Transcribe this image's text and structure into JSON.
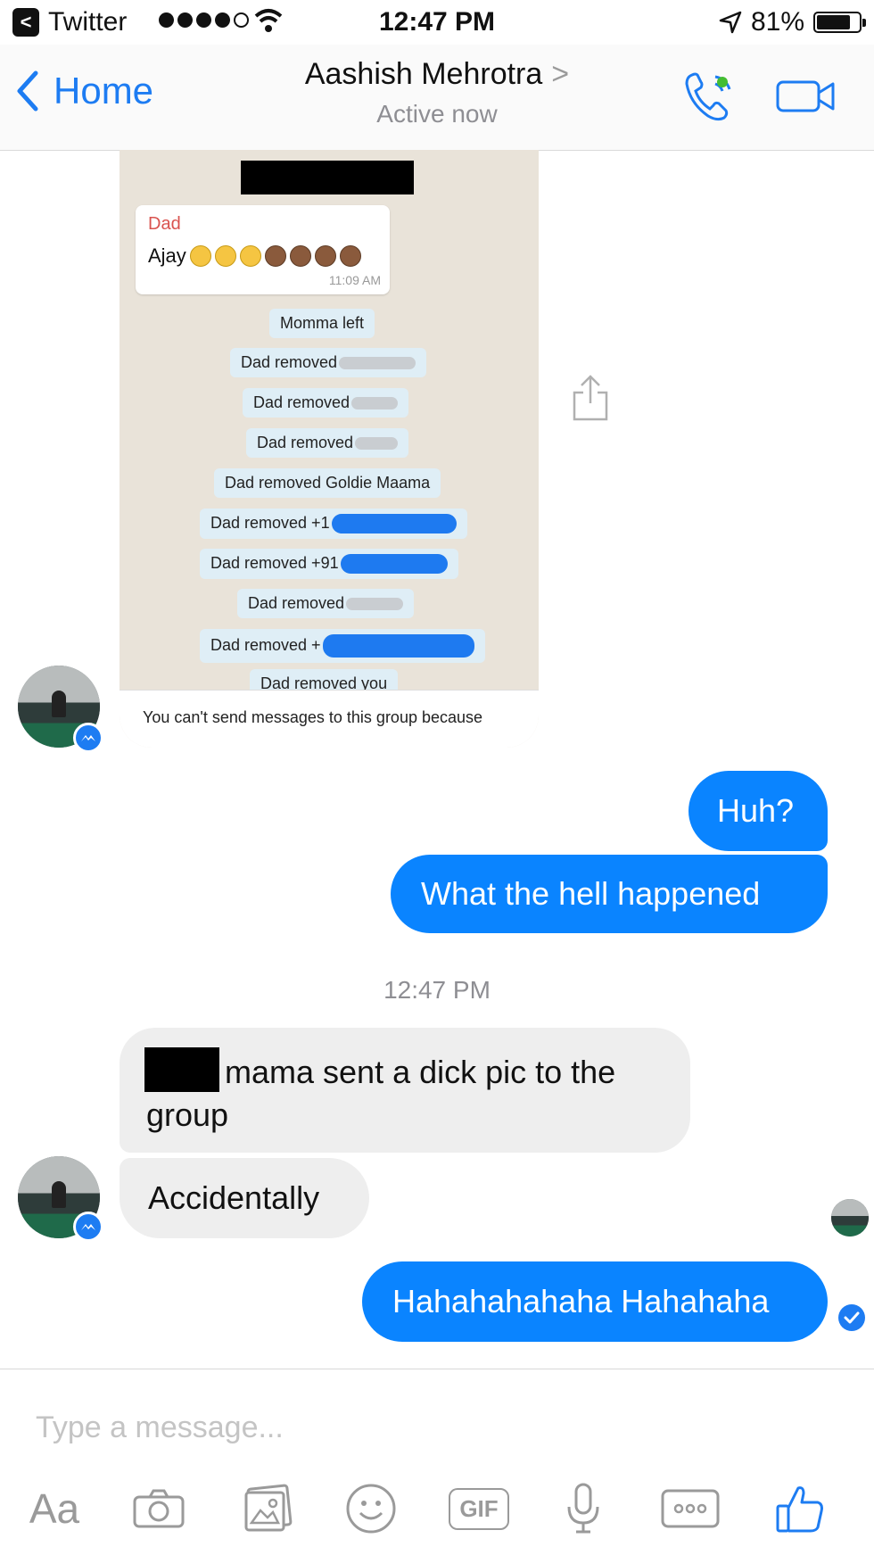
{
  "status_bar": {
    "back_app": "Twitter",
    "back_glyph": "<",
    "time": "12:47 PM",
    "battery": "81%",
    "battery_level": 0.81,
    "signal_bars_filled": 4,
    "signal_bars_total": 5
  },
  "nav": {
    "back_label": "Home",
    "contact_name": "Aashish Mehrotra",
    "title_chevron": ">",
    "status": "Active now",
    "accent_color": "#1d7cf2"
  },
  "shared_image": {
    "message": {
      "sender": "Dad",
      "text": "Ajay",
      "time": "11:09 AM"
    },
    "system_messages": [
      "Momma left",
      "Dad removed",
      "Dad removed",
      "Dad removed",
      "Dad removed Goldie Maama",
      "Dad removed +1",
      "Dad removed +91",
      "Dad removed",
      "Dad removed +",
      "Dad removed you"
    ],
    "footer": "You can't send messages to this group because"
  },
  "conversation": {
    "outgoing_1": "Huh?",
    "outgoing_2": "What the hell happened",
    "timestamp": "12:47 PM",
    "incoming_1": "mama sent a dick pic to the group",
    "incoming_2": "Accidentally",
    "outgoing_3": "Hahahahahaha Hahahaha",
    "outgoing_color": "#0a84ff",
    "incoming_color": "#eeeeee"
  },
  "composer": {
    "placeholder": "Type a message...",
    "aa_label": "Aa",
    "gif_label": "GIF",
    "icons": [
      "camera-icon",
      "photo-icon",
      "emoji-icon",
      "gif-icon",
      "microphone-icon",
      "more-icon",
      "thumbs-up-icon"
    ]
  }
}
